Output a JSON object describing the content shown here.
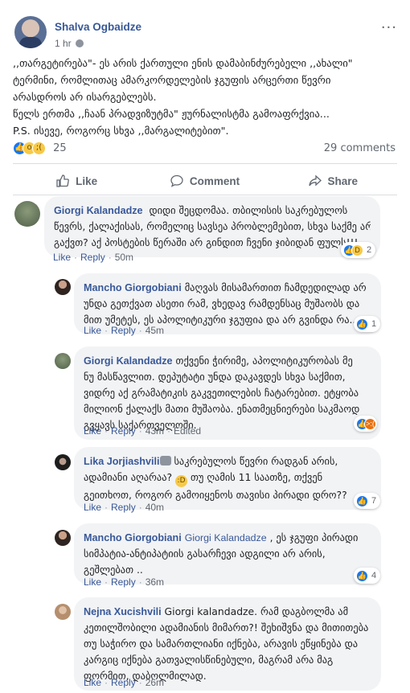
{
  "post": {
    "author": "Shalva Ogbaidze",
    "time": "1 hr",
    "more_icon": "more-horizontal-icon",
    "lines": [
      ",,თარგეტირება\"- ეს არის ქართული ენის დამაბინძურებელი ,,ახალი\"",
      "ტერმინი, რომლითაც ამარკორდელების ჯგუფის არცერთი წევრი",
      "არასდროს არ ისარგებლებს.",
      "წელს ერთმა ,,ჩაან პრადვიზუტმა\" ჟურნალისტმა გამოაფრქვია...",
      "P.S. ისევე, როგორც სხვა ,,მარგალიტებით\"."
    ],
    "reaction_count": "25",
    "comments_count": "29 comments"
  },
  "actions": {
    "like": "Like",
    "comment": "Comment",
    "share": "Share"
  },
  "comments": [
    {
      "name": "Giorgi Kalandadze",
      "lines": [
        "დიდი შეცდომაა. თბილისის საკრებულოს",
        "წევრს, ქალაქისას, რომელიც სავსეა პრობლემებით, სხვა საქმე არ",
        "გაქვთ? აქ პოსტების წერაში არ გინდით ჩვენი ჯიბიდან ფულს!!!"
      ],
      "like": "Like",
      "reply": "Reply",
      "time": "50m",
      "reaction_count": "2"
    },
    {
      "name": "Mancho Giorgobiani",
      "lines": [
        "მაღვას მისამართით ჩამდედილად არ",
        "უნდა გეთქვათ ასეთი რამ, ვხედავ რამდენსაც მუშაობს და",
        "მით უმეტეს, ეს აპოლიტიკური ჯგუფია და არ გვინდა რა.."
      ],
      "like": "Like",
      "reply": "Reply",
      "time": "45m",
      "reaction_count": "1"
    },
    {
      "name": "Giorgi Kalandadze",
      "lines": [
        "თქვენი ჭირიმე, აპოლიტიკურობას მე",
        "ნუ მასწავლით. დეპუტატი უნდა დაკავდეს სხვა საქმით,",
        "ვიდრე აქ გრამატიკის გაკვეთილების ჩატარებით. ეტყობა",
        "მილიონ ქალაქს მათი მუშაობა. ენათმეცნიერები საკმაოდ",
        "გვყავს საქართველოში."
      ],
      "like": "Like",
      "reply": "Reply",
      "time": "43m",
      "edited": "Edited"
    },
    {
      "name": "Lika Jorjiashvili",
      "lines": [
        "საკრებულოს წევრი რადგან არის,",
        "ადამიანი აღარაა?",
        "გეითხოთ, როგორ გამოიყენოს თავისი პირადი დრო??"
      ],
      "line2_rest": "თუ ღამის 11 საათზე, თქვენ",
      "like": "Like",
      "reply": "Reply",
      "time": "40m",
      "reaction_count": "7"
    },
    {
      "name": "Mancho Giorgobiani",
      "tag": "Giorgi Kalandadze",
      "lines": [
        ", ეს ჯგუფი პირადი",
        "სიმპატია-ანტიპატიის გასარჩევი ადგილი არ არის,",
        "გეშლებათ .."
      ],
      "like": "Like",
      "reply": "Reply",
      "time": "36m",
      "reaction_count": "4"
    },
    {
      "name": "Nejna Xucishvili",
      "lines": [
        "Giorgi kalandadze. რამ დაგბოლმა ამ",
        "კეთილშობილი ადამიანის მიმართ?! შეხიშვნა და მითითება",
        "თუ საჭირო და სამართლიანი იქნება, არავის ეწყინება და",
        "კარგიც იქნება გათვალისწინებული, მაგრამ არა მაგ",
        "ფორმით, დაბოლმილად."
      ],
      "like": "Like",
      "reply": "Reply",
      "time": "26m"
    }
  ]
}
